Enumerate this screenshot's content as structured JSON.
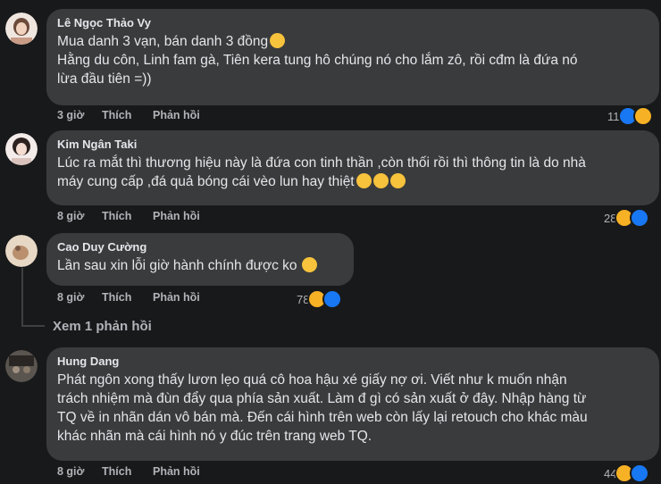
{
  "comments": [
    {
      "author": "Lê Ngọc Thảo Vy",
      "lines": [
        "Mua danh 3 vạn, bán danh 3 đồng",
        "Hằng du côn, Linh fam gà, Tiên kera tung hô chúng nó cho lắm zô, rồi cđm là đứa nó",
        "lừa đầu tiên =))"
      ],
      "time": "3 giờ",
      "like": "Thích",
      "reply": "Phản hồi",
      "reactions": "11",
      "avatar_color": "#c79a84"
    },
    {
      "author": "Kim Ngân Taki",
      "lines": [
        "Lúc ra mắt thì thương hiệu này là đứa con tinh thần ,còn thối rồi thì thông tin là do nhà",
        "máy cung cấp ,đá quả bóng cái vèo lun hay thiệt"
      ],
      "time": "8 giờ",
      "like": "Thích",
      "reply": "Phản hồi",
      "reactions": "28",
      "avatar_color": "#e8d8d4"
    },
    {
      "author": "Cao Duy Cường",
      "lines": [
        "Lần sau xin lỗi giờ hành chính được ko"
      ],
      "time": "8 giờ",
      "like": "Thích",
      "reply": "Phản hồi",
      "reactions": "78",
      "avatar_color": "#d8c3a6"
    },
    {
      "author": "Hung Dang",
      "lines": [
        "Phát ngôn xong thấy lươn lẹo quá cô hoa hậu xé giấy nợ ơi. Viết như k muốn nhận",
        "trách nhiệm mà đùn đẩy qua phía sản xuất. Làm đ gì có sản xuất ở đây. Nhập hàng từ",
        "TQ về in nhãn dán vô bán mà. Đến cái hình trên web còn lấy lại retouch cho khác màu",
        "khác nhãn mà cái hình nó y đúc trên trang web TQ."
      ],
      "time": "8 giờ",
      "like": "Thích",
      "reply": "Phản hồi",
      "reactions": "44",
      "avatar_color": "#4a4540"
    }
  ],
  "view_replies": "Xem 1 phản hồi"
}
